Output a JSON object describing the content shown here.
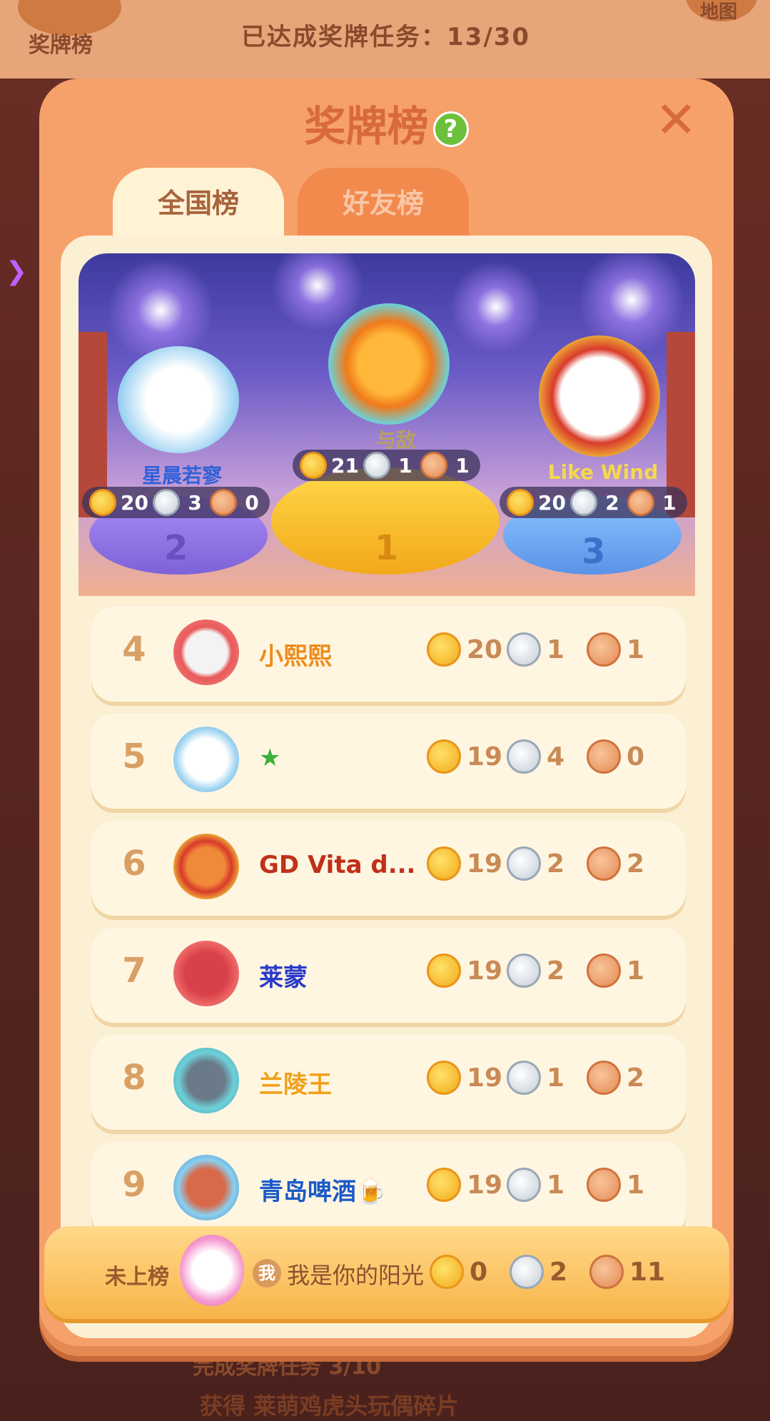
{
  "background": {
    "medal_button_label": "奖牌榜",
    "progress_text": "已达成奖牌任务：13/30",
    "map_label": "地图",
    "bottom_line1": "完成奖牌任务 3/10",
    "bottom_line2": "获得 莱萌鸡虎头玩偶碎片"
  },
  "dialog": {
    "title": "奖牌榜",
    "tabs": [
      {
        "label": "全国榜",
        "active": true
      },
      {
        "label": "好友榜",
        "active": false
      }
    ]
  },
  "podium": {
    "first": {
      "rank": "1",
      "name": "与敌",
      "gold": "21",
      "silver": "1",
      "bronze": "1"
    },
    "second": {
      "rank": "2",
      "name": "星晨若寥",
      "gold": "20",
      "silver": "3",
      "bronze": "0"
    },
    "third": {
      "rank": "3",
      "name": "Like  Wind",
      "gold": "20",
      "silver": "2",
      "bronze": "1"
    }
  },
  "rows": [
    {
      "rank": "4",
      "name": "小熙熙",
      "gold": "20",
      "silver": "1",
      "bronze": "1"
    },
    {
      "rank": "5",
      "name": "★",
      "gold": "19",
      "silver": "4",
      "bronze": "0"
    },
    {
      "rank": "6",
      "name": "GD Vita d...",
      "gold": "19",
      "silver": "2",
      "bronze": "2"
    },
    {
      "rank": "7",
      "name": "莱蒙",
      "gold": "19",
      "silver": "2",
      "bronze": "1"
    },
    {
      "rank": "8",
      "name": "兰陵王",
      "gold": "19",
      "silver": "1",
      "bronze": "2"
    },
    {
      "rank": "9",
      "name": "青岛啤酒🍺",
      "gold": "19",
      "silver": "1",
      "bronze": "1"
    }
  ],
  "me": {
    "status": "未上榜",
    "badge": "我",
    "name": "我是你的阳光",
    "gold": "0",
    "silver": "2",
    "bronze": "11"
  },
  "colors": {
    "dialog_bg": "#f6a06a",
    "panel_bg": "#fbf0d4",
    "title": "#d86a3a",
    "rank_text": "#d9a066"
  }
}
